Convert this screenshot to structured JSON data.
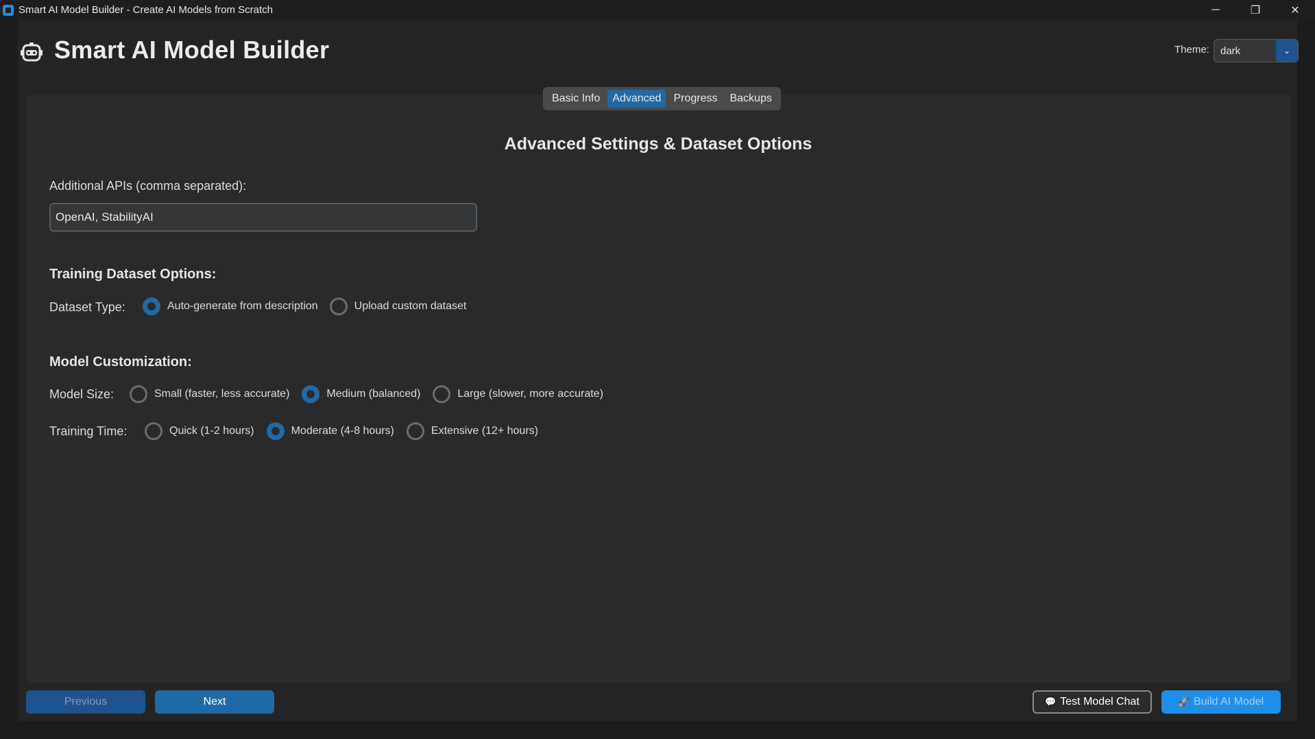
{
  "window": {
    "title": "Smart AI Model Builder - Create AI Models from Scratch",
    "minimize": "─",
    "restore": "❐",
    "close": "✕"
  },
  "header": {
    "heading": "Smart AI Model Builder",
    "theme_label": "Theme:",
    "theme_value": "dark",
    "theme_arrow": "⌄"
  },
  "tabs": [
    {
      "label": "Basic Info",
      "active": false
    },
    {
      "label": "Advanced",
      "active": true
    },
    {
      "label": "Progress",
      "active": false
    },
    {
      "label": "Backups",
      "active": false
    }
  ],
  "advanced": {
    "section_title": "Advanced Settings & Dataset Options",
    "apis_label": "Additional APIs (comma separated):",
    "apis_value": "OpenAI, StabilityAI",
    "dataset_heading": "Training Dataset Options:",
    "dataset_type_label": "Dataset Type:",
    "dataset_options": [
      {
        "label": "Auto-generate from description",
        "checked": true
      },
      {
        "label": "Upload custom dataset",
        "checked": false
      }
    ],
    "customization_heading": "Model Customization:",
    "model_size_label": "Model Size:",
    "model_size_options": [
      {
        "label": "Small (faster, less accurate)",
        "checked": false
      },
      {
        "label": "Medium (balanced)",
        "checked": true
      },
      {
        "label": "Large (slower, more accurate)",
        "checked": false
      }
    ],
    "training_time_label": "Training Time:",
    "training_time_options": [
      {
        "label": "Quick (1-2 hours)",
        "checked": false
      },
      {
        "label": "Moderate (4-8 hours)",
        "checked": true
      },
      {
        "label": "Extensive (12+ hours)",
        "checked": false
      }
    ]
  },
  "footer": {
    "previous": "Previous",
    "next": "Next",
    "test_chat": "Test Model Chat",
    "test_chat_icon": "💬",
    "build": "Build AI Model",
    "build_icon": "🚀"
  },
  "colors": {
    "accent": "#1f6aa5",
    "build_button": "#1f8ee8",
    "background": "#242424"
  }
}
